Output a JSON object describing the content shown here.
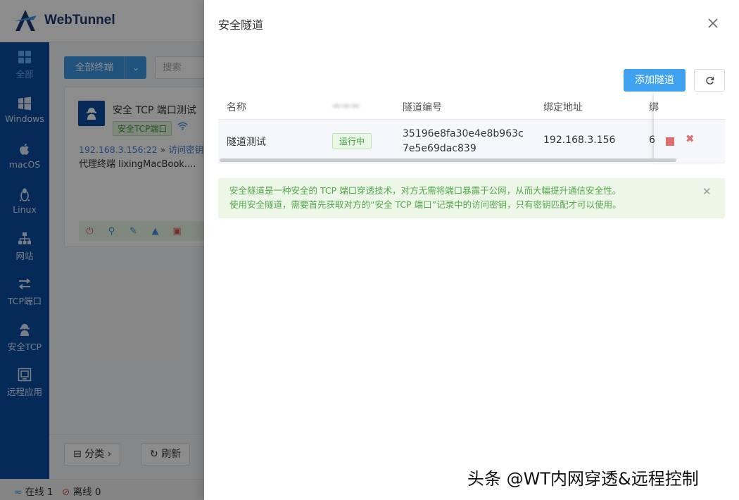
{
  "app": {
    "name": "WebTunnel",
    "brand_color": "#0a4da1",
    "accent_color": "#3c97e8"
  },
  "sidebar": {
    "items": [
      {
        "label": "全部",
        "icon": "grid-icon",
        "active": true
      },
      {
        "label": "Windows",
        "icon": "windows-icon",
        "active": false
      },
      {
        "label": "macOS",
        "icon": "apple-icon",
        "active": false
      },
      {
        "label": "Linux",
        "icon": "linux-icon",
        "active": false
      },
      {
        "label": "网站",
        "icon": "sitemap-icon",
        "active": false
      },
      {
        "label": "TCP端口",
        "icon": "exchange-icon",
        "active": false
      },
      {
        "label": "安全TCP",
        "icon": "secure-agent-icon",
        "active": false
      },
      {
        "label": "远程应用",
        "icon": "remote-app-icon",
        "active": false
      }
    ]
  },
  "toolbar": {
    "filter_label": "全部终端",
    "search_placeholder": "搜索"
  },
  "card": {
    "title": "安全 TCP 端口测试",
    "tag": "安全TCP端口",
    "address": "192.168.3.156:22",
    "separator": "»",
    "key_link": "访问密钥",
    "description": "代理终端 lixingMacBook...."
  },
  "bottom": {
    "category_label": "分类",
    "refresh_label": "刷新"
  },
  "status": {
    "online_label": "在线 1",
    "offline_label": "离线 0"
  },
  "drawer": {
    "title": "安全隧道",
    "add_button": "添加隧道",
    "table": {
      "columns": [
        "名称",
        "",
        "隧道编号",
        "绑定地址",
        "绑"
      ],
      "rows": [
        {
          "name": "隧道测试",
          "status": "运行中",
          "tunnel_id": "35196e8fa30e4e8b963c7e5e69dac839",
          "bind_address": "192.168.3.156",
          "port_partial": "6"
        }
      ]
    },
    "alert": {
      "line1": "安全隧道是一种安全的 TCP 端口穿透技术，对方无需将端口暴露于公网，从而大幅提升通信安全性。",
      "line2": "使用安全隧道，需要首先获取对方的“安全 TCP 端口”记录中的访问密钥，只有密钥匹配才可以使用。"
    }
  },
  "watermark": "头条 @WT内网穿透&远程控制"
}
